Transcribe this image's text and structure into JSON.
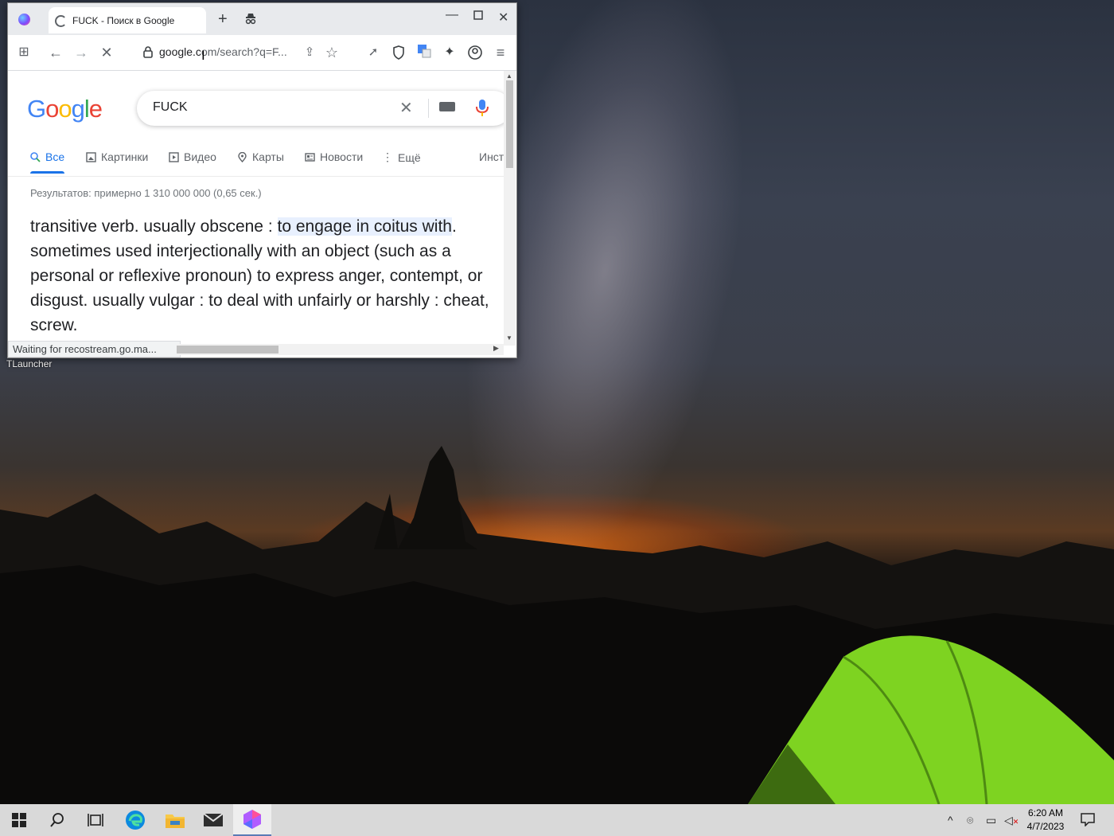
{
  "desktop": {
    "icon_label": "TLauncher"
  },
  "browser": {
    "tab_title": "FUCK - Поиск в Google",
    "address_host": "google.c",
    "address_rest": "om/search?q=F...",
    "status_text": "Waiting for recostream.go.ma..."
  },
  "google": {
    "logo": [
      "G",
      "o",
      "o",
      "g",
      "l",
      "e"
    ],
    "logo_colors": [
      "#4285F4",
      "#EA4335",
      "#FBBC05",
      "#4285F4",
      "#34A853",
      "#EA4335"
    ],
    "query": "FUCK",
    "tabs": [
      {
        "label": "Все"
      },
      {
        "label": "Картинки"
      },
      {
        "label": "Видео"
      },
      {
        "label": "Карты"
      },
      {
        "label": "Новости"
      },
      {
        "label": "Ещё"
      },
      {
        "label": "Инст"
      }
    ],
    "stats": "Результатов: примерно 1 310 000 000 (0,65 сек.)",
    "snippet_pre": "transitive verb. usually obscene : ",
    "snippet_highlight": "to engage in coitus with",
    "snippet_post": ". sometimes used interjectionally with an object (such as a personal or reflexive pronoun) to express anger, contempt, or disgust. usually vulgar : to deal with unfairly or harshly : cheat, screw."
  },
  "taskbar": {
    "time": "6:20 AM",
    "date": "4/7/2023",
    "icons": [
      "windows-start-icon",
      "search-icon",
      "task-view-icon",
      "edge-icon",
      "file-explorer-icon",
      "mail-icon",
      "browser-app-icon"
    ]
  },
  "colors": {
    "accent": "#1a73e8",
    "taskbar": "#d9d9d9"
  }
}
